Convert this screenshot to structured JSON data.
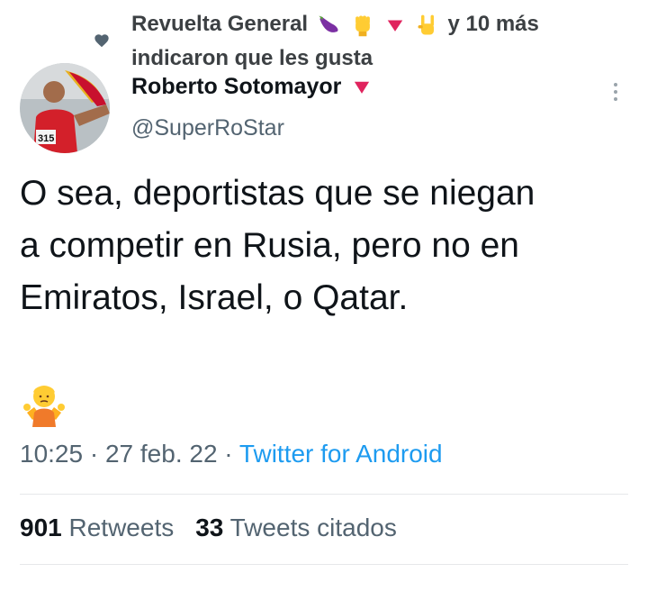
{
  "social_context": {
    "line1_name": "Revuelta General",
    "line1_suffix": "y 10 más",
    "line2": "indicaron que les gusta",
    "emojis": [
      "eggplant-icon",
      "raised-fist-icon",
      "red-triangle-icon",
      "rock-on-hand-icon"
    ]
  },
  "author": {
    "name": "Roberto Sotomayor",
    "handle": "@SuperRoStar",
    "avatar_bib": "315",
    "badge": "red-triangle-icon"
  },
  "tweet": {
    "lines": [
      "O sea, deportistas que se niegan",
      "a competir en Rusia, pero no en",
      "Emiratos, Israel, o Qatar."
    ],
    "emoji": "person-shrugging-icon"
  },
  "meta": {
    "time": "10:25",
    "sep1": " · ",
    "date": "27 feb. 22",
    "sep2": " · ",
    "source": "Twitter for Android"
  },
  "stats": {
    "retweets_count": "901",
    "retweets_label": "Retweets",
    "quotes_count": "33",
    "quotes_label": "Tweets citados"
  },
  "colors": {
    "text": "#0f1419",
    "secondary": "#536471",
    "link": "#1d9bf0",
    "triangle": "#e0245e"
  }
}
